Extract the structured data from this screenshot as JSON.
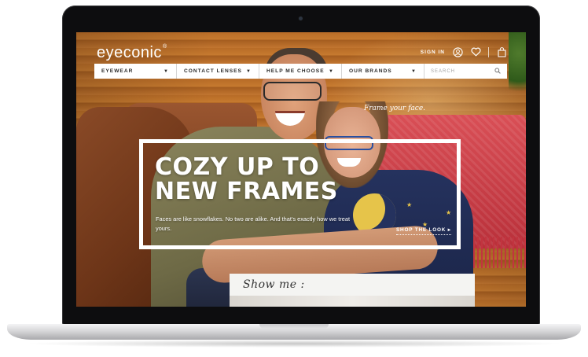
{
  "site": {
    "logo": "eyeconic",
    "logo_mark": "®"
  },
  "header": {
    "sign_in": "SIGN IN",
    "icons": [
      "user-icon",
      "heart-icon",
      "bag-icon"
    ]
  },
  "nav": {
    "items": [
      {
        "label": "EYEWEAR"
      },
      {
        "label": "CONTACT LENSES"
      },
      {
        "label": "HELP ME CHOOSE"
      },
      {
        "label": "OUR BRANDS"
      }
    ],
    "search_placeholder": "SEARCH"
  },
  "hero": {
    "tagline": "Frame your face.",
    "title_line1": "COZY UP TO",
    "title_line2": "NEW FRAMES",
    "subtitle": "Faces are like snowflakes. No two are alike. And that's exactly how we treat yours.",
    "cta": "SHOP THE LOOK"
  },
  "panel": {
    "show_me": "Show me :"
  },
  "colors": {
    "nav_bg": "#ffffff",
    "hero_text": "#ffffff",
    "bezel": "#0d0d0f"
  }
}
